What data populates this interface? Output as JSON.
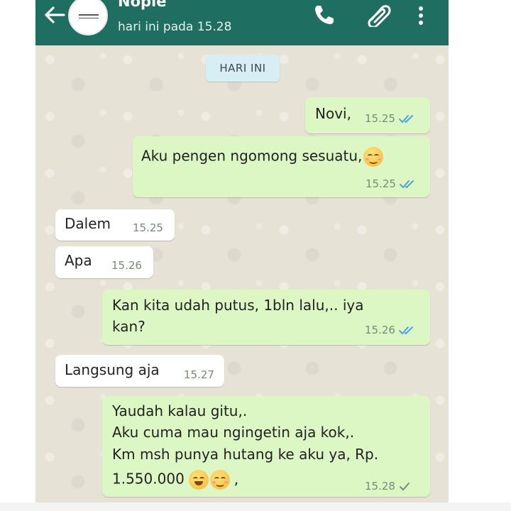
{
  "header": {
    "contact_name": "Nopie",
    "last_seen": "hari ini pada 15.28"
  },
  "chat": {
    "date_chip": "HARI INI",
    "messages": [
      {
        "direction": "outgoing",
        "lines": [
          "Novi,"
        ],
        "time": "15.25",
        "status": "read"
      },
      {
        "direction": "outgoing",
        "lines": [
          "Aku pengen ngomong sesuatu,"
        ],
        "emoji": [
          "smiling-face-icon"
        ],
        "time": "15.25",
        "status": "read"
      },
      {
        "direction": "incoming",
        "lines": [
          "Dalem"
        ],
        "time": "15.25"
      },
      {
        "direction": "incoming",
        "lines": [
          "Apa"
        ],
        "time": "15.26"
      },
      {
        "direction": "outgoing",
        "lines": [
          "Kan kita udah putus, 1bln lalu,.. iya",
          "kan?"
        ],
        "time": "15.26",
        "status": "read"
      },
      {
        "direction": "incoming",
        "lines": [
          "Langsung aja"
        ],
        "time": "15.27"
      },
      {
        "direction": "outgoing",
        "lines": [
          "Yaudah kalau gitu,.",
          "Aku cuma mau ngingetin aja kok,.",
          "Km msh punya hutang ke aku ya, Rp.",
          "1.550.000"
        ],
        "emoji": [
          "grinning-face-icon",
          "smiling-face-icon"
        ],
        "trailing_text": ",",
        "time": "15.28",
        "status": "sent"
      }
    ]
  },
  "colors": {
    "header_bg": "#1f6e62",
    "outgoing_bubble": "#dcf6c4",
    "incoming_bubble": "#ffffff",
    "chat_bg": "#e6e2d6",
    "read_tick": "#4fa3d9"
  }
}
